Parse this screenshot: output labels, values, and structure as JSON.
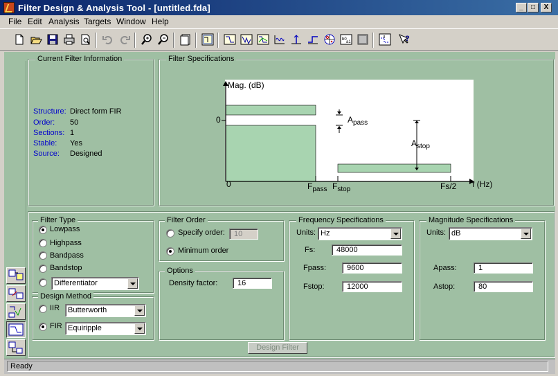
{
  "window": {
    "title": "Filter Design & Analysis Tool - [untitled.fda]",
    "controls": {
      "minimize": "_",
      "maximize": "□",
      "close": "X"
    }
  },
  "menu": [
    "File",
    "Edit",
    "Analysis",
    "Targets",
    "Window",
    "Help"
  ],
  "toolbar": {
    "icons": [
      "new-icon",
      "open-icon",
      "save-icon",
      "print-icon",
      "print-preview-icon",
      "undo-icon",
      "redo-icon",
      "zoom-in-icon",
      "zoom-out-icon",
      "new-figure-icon",
      "full-view-icon",
      "magnitude-icon",
      "phase-icon",
      "mag-phase-icon",
      "group-delay-icon",
      "impulse-icon",
      "step-icon",
      "pole-zero-icon",
      "coefficients-icon",
      "filter-info-icon",
      "design-mode-icon",
      "whats-this-icon"
    ]
  },
  "sidebar": {
    "icons": [
      "quantize-icon",
      "transform-icon",
      "import-icon",
      "design-filter-icon",
      "realize-icon"
    ]
  },
  "current_filter_info": {
    "label": "Current Filter Information",
    "rows": [
      {
        "key": "Structure:",
        "value": "Direct form FIR"
      },
      {
        "key": "Order:",
        "value": "50"
      },
      {
        "key": "Sections:",
        "value": "1"
      },
      {
        "key": "Stable:",
        "value": "Yes"
      },
      {
        "key": "Source:",
        "value": "Designed"
      }
    ]
  },
  "filter_specifications": {
    "label": "Filter Specifications",
    "plot": {
      "y_axis_label": "Mag. (dB)",
      "zero_label": "0",
      "x_zero_label": "0",
      "x_axis_label": "f (Hz)",
      "fpass_label": "F",
      "fpass_sub": "pass",
      "fstop_label": "F",
      "fstop_sub": "stop",
      "fs2_label": "Fs/2",
      "apass_label": "A",
      "apass_sub": "pass",
      "astop_label": "A",
      "astop_sub": "stop"
    }
  },
  "filter_type": {
    "label": "Filter Type",
    "options": [
      "Lowpass",
      "Highpass",
      "Bandpass",
      "Bandstop"
    ],
    "selected": "Lowpass",
    "other_popup": "Differentiator"
  },
  "design_method": {
    "label": "Design Method",
    "iir_label": "IIR",
    "iir_popup": "Butterworth",
    "fir_label": "FIR",
    "fir_popup": "Equiripple",
    "selected": "FIR"
  },
  "filter_order": {
    "label": "Filter Order",
    "specify_label": "Specify order:",
    "specify_value": "10",
    "minimum_label": "Minimum order",
    "selected": "Minimum order"
  },
  "options": {
    "label": "Options",
    "density_label": "Density factor:",
    "density_value": "16"
  },
  "frequency_specs": {
    "label": "Frequency Specifications",
    "units_label": "Units:",
    "units_value": "Hz",
    "fields": [
      {
        "label": "Fs:",
        "value": "48000"
      },
      {
        "label": "Fpass:",
        "value": "9600"
      },
      {
        "label": "Fstop:",
        "value": "12000"
      }
    ]
  },
  "magnitude_specs": {
    "label": "Magnitude Specifications",
    "units_label": "Units:",
    "units_value": "dB",
    "fields": [
      {
        "label": "Apass:",
        "value": "1"
      },
      {
        "label": "Astop:",
        "value": "80"
      }
    ]
  },
  "design_button": "Design Filter",
  "status": "Ready"
}
